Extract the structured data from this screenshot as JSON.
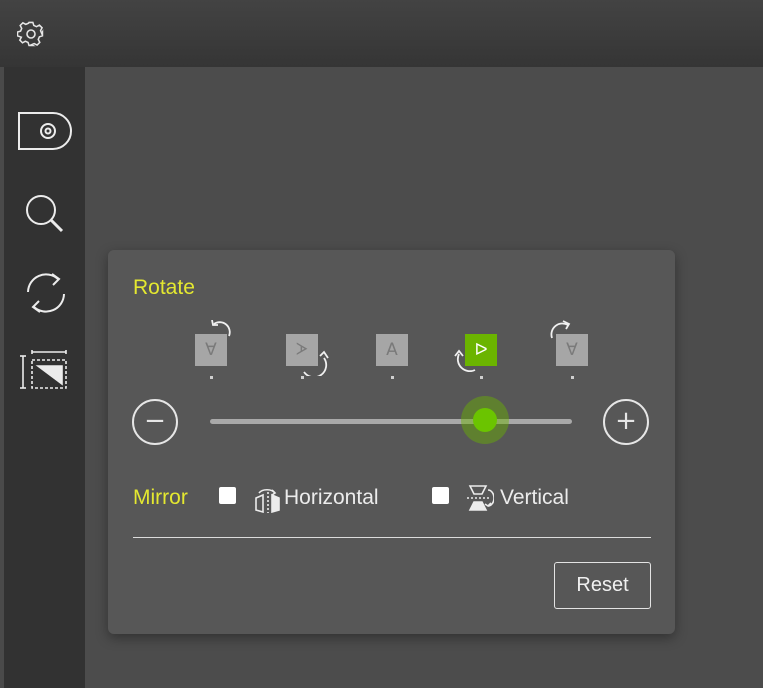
{
  "toolbar": {
    "settings_icon": "gear-icon"
  },
  "sidebar": {
    "items": [
      {
        "name": "disc-icon"
      },
      {
        "name": "magnifier-icon"
      },
      {
        "name": "rotate-icon"
      },
      {
        "name": "crop-icon"
      }
    ]
  },
  "panel": {
    "rotate_title": "Rotate",
    "presets": [
      {
        "letter": "∀"
      },
      {
        "letter": "ᗆ"
      },
      {
        "letter": "A"
      },
      {
        "letter": "ᐅ",
        "active": true
      },
      {
        "letter": "∀"
      }
    ],
    "slider": {
      "minus": "−",
      "plus": "+",
      "value_fraction": 0.76
    },
    "mirror": {
      "label": "Mirror",
      "horizontal": "Horizontal",
      "vertical": "Vertical"
    },
    "reset_label": "Reset"
  },
  "colors": {
    "accent_yellow": "#e4e830",
    "accent_green": "#6bb400"
  }
}
